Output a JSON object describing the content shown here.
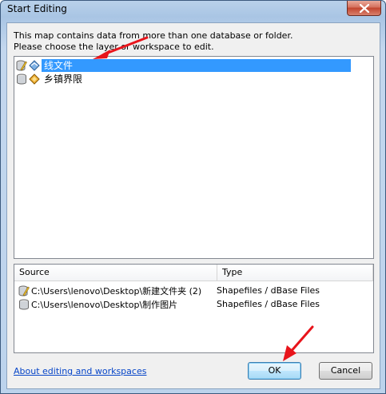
{
  "window": {
    "title": "Start Editing",
    "close_icon": "close-icon"
  },
  "message": {
    "line1": "This map contains data from more than one database or folder.",
    "line2": "Please choose the layer or workspace to edit."
  },
  "layers": [
    {
      "label": "线文件",
      "selected": true,
      "icon": "editable-layer-icon",
      "type_icon": "line-feature-icon"
    },
    {
      "label": "乡镇界限",
      "selected": false,
      "icon": "database-icon",
      "type_icon": "polygon-feature-icon"
    }
  ],
  "sources": {
    "headers": [
      "Source",
      "Type"
    ],
    "rows": [
      {
        "source": "C:\\Users\\lenovo\\Desktop\\新建文件夹 (2)",
        "type": "Shapefiles / dBase Files",
        "icon": "editable-workspace-icon"
      },
      {
        "source": "C:\\Users\\lenovo\\Desktop\\制作图片",
        "type": "Shapefiles / dBase Files",
        "icon": "database-icon"
      }
    ]
  },
  "footer": {
    "help_link": "About editing and workspaces",
    "ok_label": "OK",
    "cancel_label": "Cancel"
  },
  "colors": {
    "selection": "#3399ff",
    "link": "#0645c8",
    "annotation_arrow": "#e8141b"
  }
}
